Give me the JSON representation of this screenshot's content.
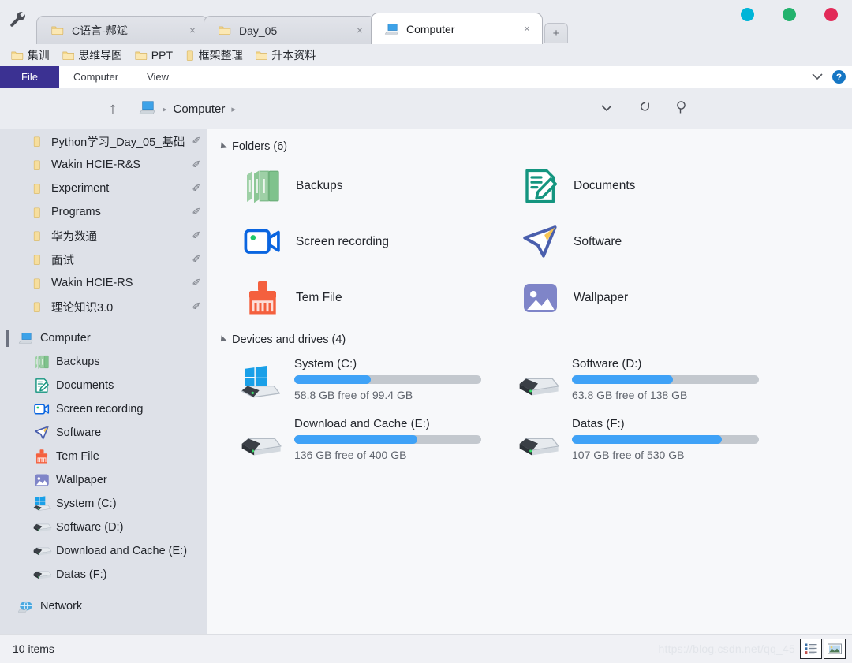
{
  "window": {
    "controls": [
      {
        "name": "minimize",
        "color": "#00b5d8"
      },
      {
        "name": "maximize",
        "color": "#23b26d"
      },
      {
        "name": "close",
        "color": "#e22a58"
      }
    ],
    "tool_icon": "wrench-icon"
  },
  "tabs": {
    "items": [
      {
        "label": "C语言-郝斌",
        "icon": "folder-icon",
        "active": false,
        "close": "×"
      },
      {
        "label": "Day_05",
        "icon": "folder-icon",
        "active": false,
        "close": "×"
      },
      {
        "label": "Computer",
        "icon": "computer-icon",
        "active": true,
        "close": "×"
      }
    ],
    "new_tab_label": "+"
  },
  "bookmarks": [
    {
      "label": "集训",
      "icon": "folder-icon"
    },
    {
      "label": "思维导图",
      "icon": "folder-icon"
    },
    {
      "label": "PPT",
      "icon": "folder-icon"
    },
    {
      "label": "框架整理",
      "icon": "folder-plain-icon"
    },
    {
      "label": "升本资料",
      "icon": "folder-icon"
    }
  ],
  "ribbon": {
    "file_label": "File",
    "tabs": [
      "Computer",
      "View"
    ],
    "expand_icon": "chevron-down-icon",
    "help_label": "?",
    "file_color": "#3b3192"
  },
  "address": {
    "up_icon": "arrow-up-icon",
    "path_icon": "computer-icon",
    "crumb": "Computer",
    "sep": "▸",
    "dropdown_icon": "chevron-down-icon",
    "refresh_icon": "refresh-icon",
    "search_icon": "search-icon"
  },
  "sidebar": {
    "pinned": [
      {
        "label": "Python学习_Day_05_基础",
        "pin": "✐"
      },
      {
        "label": "Wakin HCIE-R&S",
        "pin": "✐"
      },
      {
        "label": "Experiment",
        "pin": "✐"
      },
      {
        "label": "Programs",
        "pin": "✐"
      },
      {
        "label": "华为数通",
        "pin": "✐"
      },
      {
        "label": "面试",
        "pin": "✐"
      },
      {
        "label": "Wakin HCIE-RS",
        "pin": "✐"
      },
      {
        "label": "理论知识3.0",
        "pin": "✐"
      }
    ],
    "computer": {
      "label": "Computer",
      "icon": "computer-icon"
    },
    "children": [
      {
        "label": "Backups",
        "icon": "backups-icon"
      },
      {
        "label": "Documents",
        "icon": "documents-icon"
      },
      {
        "label": "Screen recording",
        "icon": "video-camera-icon"
      },
      {
        "label": "Software",
        "icon": "paper-plane-icon"
      },
      {
        "label": "Tem File",
        "icon": "broom-icon"
      },
      {
        "label": "Wallpaper",
        "icon": "picture-icon"
      },
      {
        "label": "System (C:)",
        "icon": "windows-drive-icon"
      },
      {
        "label": "Software (D:)",
        "icon": "drive-icon"
      },
      {
        "label": "Download and Cache (E:)",
        "icon": "drive-icon"
      },
      {
        "label": "Datas (F:)",
        "icon": "drive-icon"
      }
    ],
    "network": {
      "label": "Network",
      "icon": "network-icon"
    }
  },
  "main": {
    "folders_group": {
      "title": "Folders (6)"
    },
    "folders": [
      {
        "label": "Backups",
        "icon": "backups-icon"
      },
      {
        "label": "Documents",
        "icon": "documents-icon"
      },
      {
        "label": "Screen recording",
        "icon": "video-camera-icon"
      },
      {
        "label": "Software",
        "icon": "paper-plane-icon"
      },
      {
        "label": "Tem File",
        "icon": "broom-icon"
      },
      {
        "label": "Wallpaper",
        "icon": "picture-icon"
      }
    ],
    "drives_group": {
      "title": "Devices and drives (4)"
    },
    "drives": [
      {
        "name": "System (C:)",
        "free": "58.8 GB free of 99.4 GB",
        "used_pct": 41,
        "icon": "windows-drive-icon"
      },
      {
        "name": "Software (D:)",
        "free": "63.8 GB free of 138 GB",
        "used_pct": 54,
        "icon": "drive-icon"
      },
      {
        "name": "Download and Cache (E:)",
        "free": "136 GB free of 400 GB",
        "used_pct": 66,
        "icon": "drive-icon"
      },
      {
        "name": "Datas (F:)",
        "free": "107 GB free of 530 GB",
        "used_pct": 80,
        "icon": "drive-icon"
      }
    ]
  },
  "status": {
    "items_text": "10 items",
    "watermark": "https://blog.csdn.net/qq_45",
    "views": [
      {
        "name": "details-view",
        "icon": "list-view-icon"
      },
      {
        "name": "large-icons-view",
        "icon": "thumbnail-view-icon"
      }
    ]
  },
  "colors": {
    "accent_blue": "#3fa2f7",
    "sidebar_bg": "#dee1e8",
    "content_bg": "#f7f8fa"
  }
}
